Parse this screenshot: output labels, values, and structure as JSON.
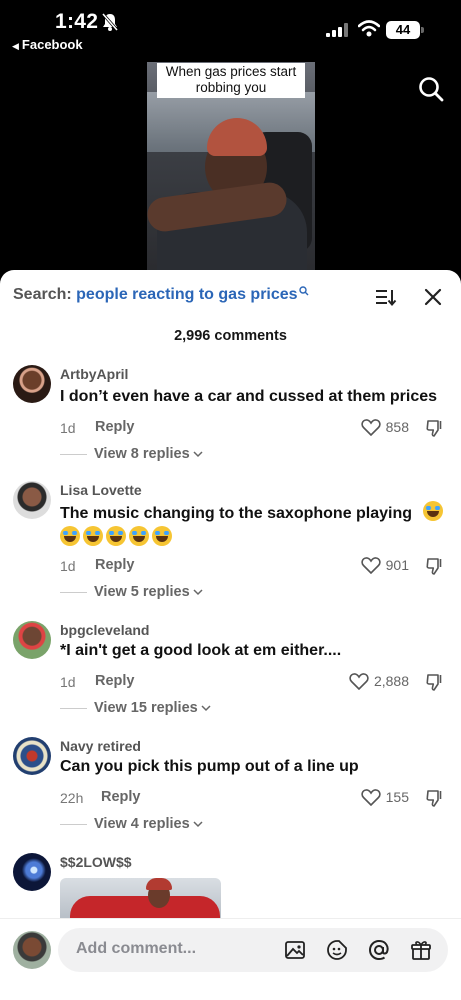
{
  "status_bar": {
    "time": "1:42",
    "back_app": "Facebook",
    "battery": "44"
  },
  "video": {
    "caption": "When gas prices start robbing you"
  },
  "comments_sheet": {
    "search_label": "Search:",
    "search_query": "people reacting to gas prices",
    "count_label": "2,996 comments",
    "reply_label": "Reply",
    "comments": [
      {
        "user": "ArtbyApril",
        "text": "I don’t even have a car and cussed at them prices",
        "age": "1d",
        "likes": "858",
        "view_replies": "View 8 replies"
      },
      {
        "user": "Lisa Lovette",
        "text": "The music changing to the saxophone playing",
        "age": "1d",
        "likes": "901",
        "view_replies": "View 5 replies",
        "emoji_count": 6
      },
      {
        "user": "bpgcleveland",
        "text": "*I ain't get a good look at em either....",
        "age": "1d",
        "likes": "2,888",
        "view_replies": "View 15 replies"
      },
      {
        "user": "Navy retired",
        "text": "Can you pick this pump out of a line up",
        "age": "22h",
        "likes": "155",
        "view_replies": "View 4 replies"
      },
      {
        "user": "$$2LOW$$"
      }
    ]
  },
  "input": {
    "placeholder": "Add comment..."
  },
  "colors": {
    "accent_blue": "#2b66b7",
    "sheet_bg": "#ffffff",
    "field_bg": "#f1f1f2"
  }
}
